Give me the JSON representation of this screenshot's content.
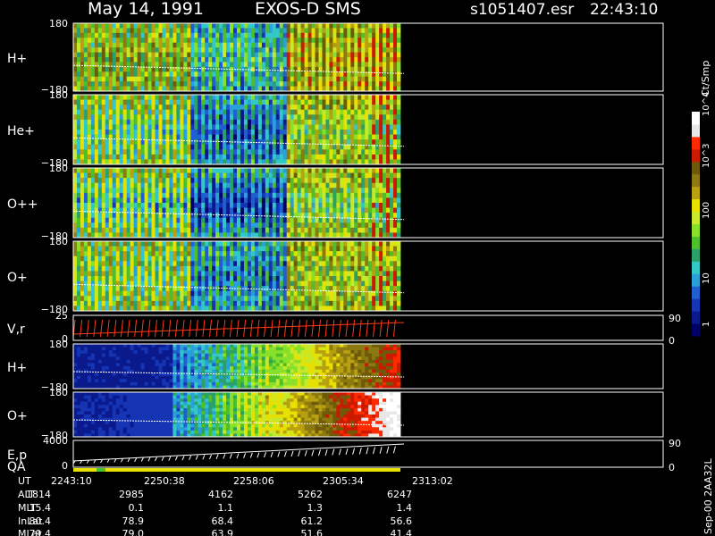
{
  "header": {
    "date": "May 14, 1991",
    "instrument": "EXOS-D SMS",
    "file": "s1051407.esr",
    "time": "22:43:10"
  },
  "colorbar": {
    "title": "Ct/Smp",
    "ticks": [
      "1",
      "10",
      "100",
      "10^3",
      "10^4"
    ],
    "colors": [
      "#000066",
      "#0a1a8c",
      "#1535b5",
      "#1f5fd0",
      "#2aa0d8",
      "#33c8c8",
      "#2aa06a",
      "#4cbf2a",
      "#88e02a",
      "#c8e82a",
      "#e8e000",
      "#b8a010",
      "#8c7a10",
      "#6e5a08",
      "#cc1a00",
      "#ff2a00",
      "#e8e8e8",
      "#ffffff"
    ]
  },
  "chart_data": [
    {
      "type": "heatmap",
      "name": "panel-hplus",
      "label": "H+",
      "ytop": "180",
      "ybottom": "−180",
      "style": "roll",
      "bias": 0.0
    },
    {
      "type": "heatmap",
      "name": "panel-heplus",
      "label": "He+",
      "ytop": "180",
      "ybottom": "−180",
      "style": "roll",
      "bias": -0.18
    },
    {
      "type": "heatmap",
      "name": "panel-oplusplus",
      "label": "O++",
      "ytop": "180",
      "ybottom": "−180",
      "style": "roll",
      "bias": -0.22
    },
    {
      "type": "heatmap",
      "name": "panel-oplus",
      "label": "O+",
      "ytop": "180",
      "ybottom": "−180",
      "style": "roll",
      "bias": -0.12
    },
    {
      "type": "line",
      "name": "panel-vr",
      "label": "V,r",
      "ytop": "25",
      "ybottom": "0",
      "right_top": "90",
      "right_bottom": "0"
    },
    {
      "type": "heatmap",
      "name": "panel-hplus-2",
      "label": "H+",
      "ytop": "180",
      "ybottom": "−180",
      "style": "ramp",
      "bias": 0.0
    },
    {
      "type": "heatmap",
      "name": "panel-oplus-2",
      "label": "O+",
      "ytop": "180",
      "ybottom": "−180",
      "style": "ramp",
      "bias": 0.15
    },
    {
      "type": "line",
      "name": "panel-ep",
      "label": "E,p",
      "label2": "QA",
      "ytop": "4000",
      "ybottom": "0",
      "right_top": "90",
      "right_bottom": "0"
    }
  ],
  "time_axis": {
    "row_labels": [
      "UT",
      "ALT",
      "MLT",
      "InLat",
      "MLat"
    ],
    "columns": [
      [
        "2243:10",
        "1814",
        "15.4",
        "80.4",
        "79.4"
      ],
      [
        "2250:38",
        "2985",
        "0.1",
        "78.9",
        "79.0"
      ],
      [
        "2258:06",
        "4162",
        "1.1",
        "68.4",
        "63.9"
      ],
      [
        "2305:34",
        "5262",
        "1.3",
        "61.2",
        "51.6"
      ],
      [
        "2313:02",
        "6247",
        "1.4",
        "56.6",
        "41.4"
      ]
    ]
  },
  "footer_stamp": "Sep-00  2AA32L"
}
